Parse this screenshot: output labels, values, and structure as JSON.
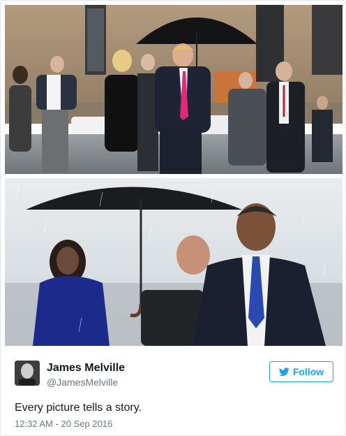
{
  "tweet": {
    "author": {
      "name": "James Melville",
      "handle": "@JamesMelville"
    },
    "follow_label": "Follow",
    "text": "Every picture tells a story.",
    "timestamp": "12:32 AM - 20 Sep 2016"
  },
  "media": {
    "photos": [
      {
        "subject": "man in navy suit and pink tie under a black umbrella walking on tarmac with group of people"
      },
      {
        "subject": "man in dark suit and blue tie walking in the rain while another man holds an umbrella behind"
      }
    ]
  },
  "colors": {
    "accent": "#1da1f2",
    "text_primary": "#14171a",
    "text_secondary": "#657786",
    "border": "#e1e8ed"
  },
  "icons": {
    "follow": "twitter-bird-icon"
  }
}
